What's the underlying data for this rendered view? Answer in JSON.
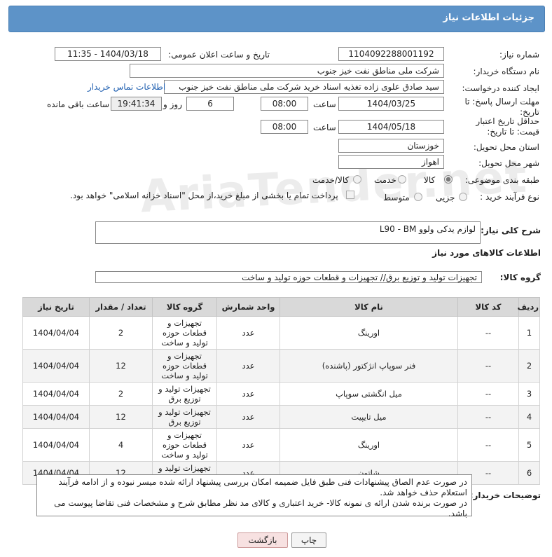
{
  "window": {
    "title": "جزئیات اطلاعات نیاز"
  },
  "watermark": "AriaTender.net",
  "fields": {
    "need_number_label": "شماره نیاز:",
    "need_number": "1104092288001192",
    "announce_label": "تاریخ و ساعت اعلان عمومی:",
    "announce_value": "1404/03/18 - 11:35",
    "buyer_org_label": "نام دستگاه خریدار:",
    "buyer_org": "شرکت ملی مناطق نفت خیز جنوب",
    "requester_label": "ایجاد کننده درخواست:",
    "requester": "سید صادق علوی زاده  تغذیه اسناد خرید  شرکت ملی مناطق نفت خیز جنوب",
    "buyer_contact_link": "اطلاعات تماس خریدار",
    "deadline_label": "مهلت ارسال پاسخ: تا تاریخ:",
    "deadline_date": "1404/03/25",
    "time_label": "ساعت",
    "deadline_time": "08:00",
    "days_value": "6",
    "days_label": "روز و",
    "remaining_time": "19:41:34",
    "remaining_label": "ساعت باقی مانده",
    "validity_label": "حداقل تاریخ اعتبار قیمت: تا تاریخ:",
    "validity_date": "1404/05/18",
    "validity_time_label": "ساعت",
    "validity_time": "08:00",
    "province_label": "استان محل تحویل:",
    "province": "خوزستان",
    "city_label": "شهر محل تحویل:",
    "city": "اهواز",
    "category_label": "طبقه بندی موضوعی:",
    "category_options": [
      "کالا",
      "خدمت",
      "کالا/خدمت"
    ],
    "process_label": "نوع فرآیند خرید :",
    "process_options": [
      "جزیی",
      "متوسط"
    ],
    "payment_note": "پرداخت تمام یا بخشی از مبلغ خرید،از محل \"اسناد خزانه اسلامی\" خواهد بود."
  },
  "summary": {
    "label": "شرح کلی نیاز:",
    "value": "لوازم یدکی ولوو L90 - BM"
  },
  "goods_section": {
    "title": "اطلاعات کالاهای مورد نیاز",
    "group_label": "گروه کالا:",
    "group_value": "تجهیزات تولید و توزیع برق// تجهیزات و قطعات حوزه تولید و ساخت"
  },
  "table": {
    "headers": [
      "ردیف",
      "کد کالا",
      "نام کالا",
      "واحد شمارش",
      "گروه کالا",
      "تعداد / مقدار",
      "تاریخ نیاز"
    ],
    "rows": [
      {
        "idx": "1",
        "code": "--",
        "name": "اورینگ",
        "unit": "عدد",
        "group": "تجهیزات و قطعات حوزه تولید و ساخت",
        "qty": "2",
        "date": "1404/04/04"
      },
      {
        "idx": "2",
        "code": "--",
        "name": "فنر سوپاپ انژکتور (پاشنده)",
        "unit": "عدد",
        "group": "تجهیزات و قطعات حوزه تولید و ساخت",
        "qty": "12",
        "date": "1404/04/04"
      },
      {
        "idx": "3",
        "code": "--",
        "name": "میل انگشتی سوپاپ",
        "unit": "عدد",
        "group": "تجهیزات تولید و توزیع برق",
        "qty": "2",
        "date": "1404/04/04"
      },
      {
        "idx": "4",
        "code": "--",
        "name": "میل تایپیت",
        "unit": "عدد",
        "group": "تجهیزات تولید و توزیع برق",
        "qty": "12",
        "date": "1404/04/04"
      },
      {
        "idx": "5",
        "code": "--",
        "name": "اورینگ",
        "unit": "عدد",
        "group": "تجهیزات و قطعات حوزه تولید و ساخت",
        "qty": "4",
        "date": "1404/04/04"
      },
      {
        "idx": "6",
        "code": "--",
        "name": "شاتون",
        "unit": "عدد",
        "group": "تجهیزات تولید و توزیع برق",
        "qty": "12",
        "date": "1404/04/04"
      }
    ]
  },
  "buyer_notes": {
    "label": "توضیحات خریدار:",
    "line1": "در صورت عدم الصاق پیشنهادات فنی طبق فایل ضمیمه امکان بررسی پیشنهاد ارائه شده میسر نبوده و از ادامه فرآیند استعلام حذف خواهد شد.",
    "line2": "در صورت برنده شدن ارائه ی نمونه کالا- خرید اعتباری و کالای مد نظر مطابق شرح و مشخصات فنی تقاضا پیوست می باشد."
  },
  "buttons": {
    "print": "چاپ",
    "back": "بازگشت"
  }
}
